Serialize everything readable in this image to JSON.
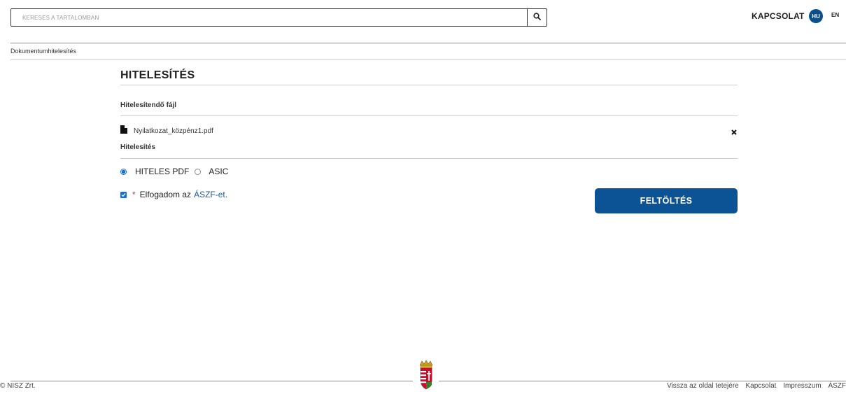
{
  "header": {
    "search": {
      "placeholder": "KERESÉS A TARTALOMBAN",
      "value": ""
    },
    "contact_label": "KAPCSOLAT",
    "languages": {
      "active": "HU",
      "other": "EN"
    }
  },
  "breadcrumb": "Dokumentumhitelesítés",
  "main": {
    "title": "HITELESÍTÉS",
    "file_section_label": "Hitelesítendő fájl",
    "file_name": "Nyilatkozat_közpénz1.pdf",
    "auth_section_label": "Hitelesítés",
    "options": [
      {
        "label": "HITELES PDF",
        "selected": true
      },
      {
        "label": "ASIC",
        "selected": false
      }
    ],
    "accept": {
      "text": "Elfogadom az",
      "link": "ÁSZF-et.",
      "checked": true,
      "required_mark": "*"
    },
    "upload_label": "FELTÖLTÉS"
  },
  "footer": {
    "copyright": "© NISZ Zrt.",
    "links": [
      "Vissza az oldal tetejére",
      "Kapcsolat",
      "Impresszum",
      "ÁSZF"
    ]
  },
  "colors": {
    "accent": "#0b5394",
    "lang_badge": "#0b4f8c",
    "radio_check": "#1a6fd0",
    "required": "#d0312d"
  }
}
